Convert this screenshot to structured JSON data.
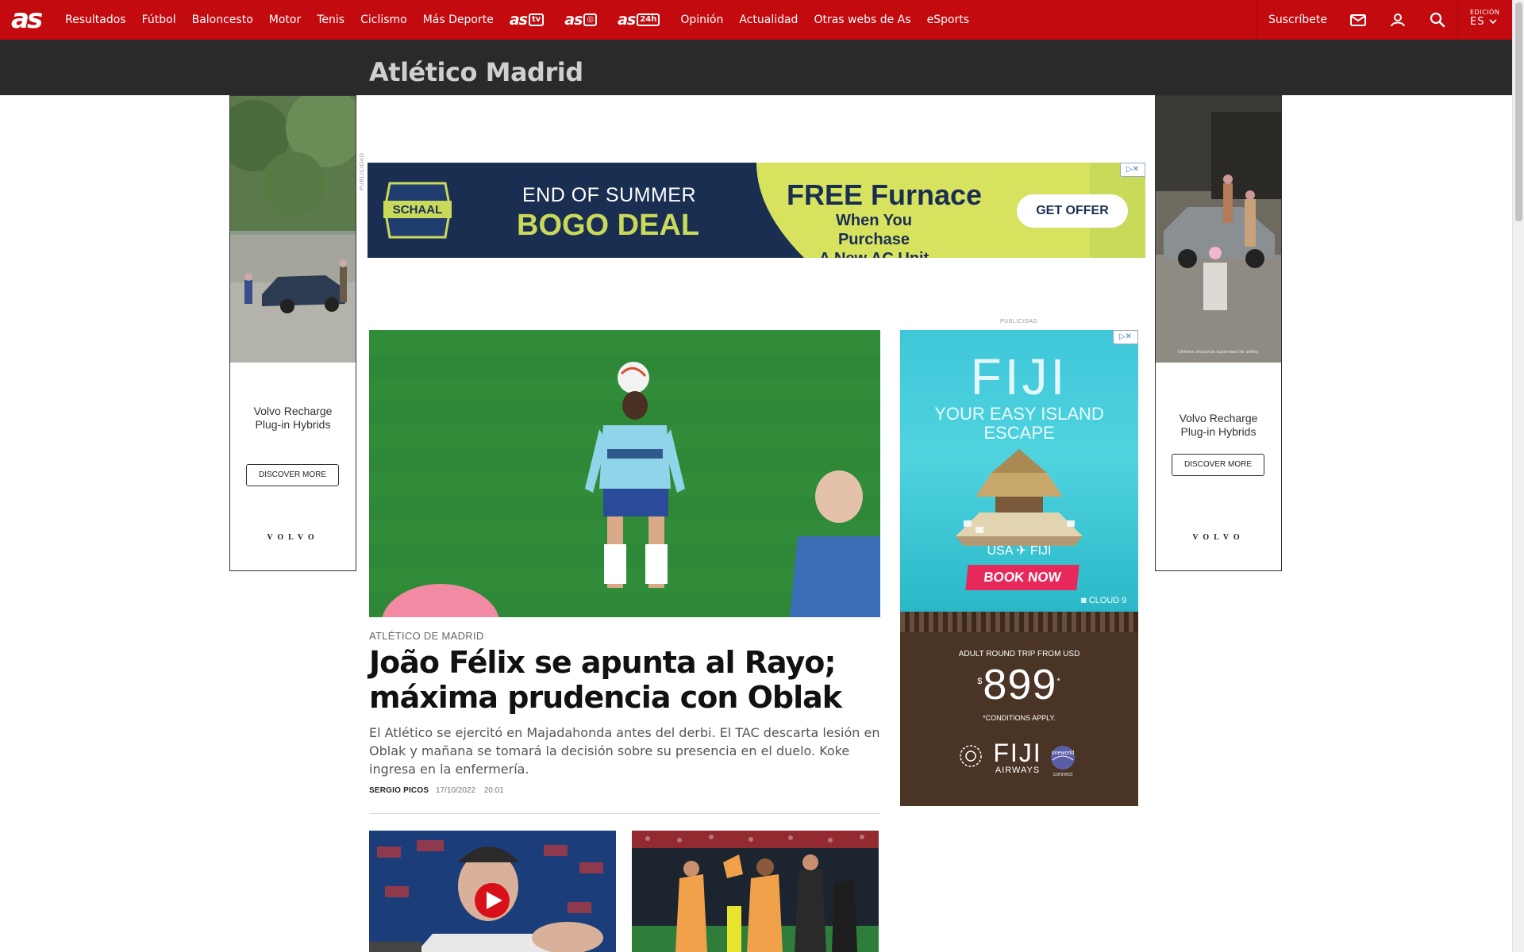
{
  "nav": {
    "logo": "as",
    "items": [
      "Resultados",
      "Fútbol",
      "Baloncesto",
      "Motor",
      "Tenis",
      "Ciclismo",
      "Más Deporte"
    ],
    "brands": [
      {
        "text": "as",
        "tag": "tv"
      },
      {
        "text": "as",
        "tag": "◎"
      },
      {
        "text": "as",
        "tag": "24h"
      }
    ],
    "items_after": [
      "Opinión",
      "Actualidad",
      "Otras webs de As",
      "eSports"
    ],
    "subscribe": "Suscríbete",
    "edition_label": "EDICIÓN",
    "edition_value": "ES",
    "icons": [
      "mail-icon",
      "user-icon",
      "search-icon",
      "chevron-down-icon"
    ]
  },
  "section": {
    "title": "Atlético Madrid"
  },
  "ads": {
    "publicidad": "PUBLICIDAD",
    "volvo": {
      "headline_line1": "Volvo Recharge",
      "headline_line2": "Plug-in Hybrids",
      "cta": "DISCOVER MORE",
      "brand": "VOLVO",
      "disclaimer": "Children should be supervised for safety."
    },
    "schaal": {
      "logo": "SCHAAL",
      "line1": "END OF SUMMER",
      "line2": "BOGO DEAL",
      "line3": "FREE Furnace",
      "line4": "When You Purchase",
      "line5": "A New AC Unit",
      "cta": "GET OFFER"
    },
    "fiji": {
      "title": "FIJI",
      "subtitle1": "YOUR EASY ISLAND",
      "subtitle2": "ESCAPE",
      "route": "USA ✈ FIJI",
      "cta": "BOOK NOW",
      "photo_credit": "CLOUD 9",
      "price_label": "ADULT ROUND TRIP FROM USD",
      "currency": "$",
      "price": "899",
      "price_mark": "*",
      "conditions": "*CONDITIONS APPLY.",
      "airline": "FIJI",
      "airline_sub": "AIRWAYS",
      "alliance": "oneworld",
      "alliance_sub": "connect"
    }
  },
  "article": {
    "kicker": "ATLÉTICO DE MADRID",
    "headline": "João Félix se apunta al Rayo; máxima prudencia con Oblak",
    "summary": "El Atlético se ejercitó en Majadahonda antes del derbi. El TAC descarta lesión en Oblak y mañana se tomará la decisión sobre su presencia en el duelo. Koke ingresa en la enfermería.",
    "author": "SERGIO PICOS",
    "date": "17/10/2022",
    "time": "20:01"
  },
  "colors": {
    "brand_red": "#c20a0f",
    "section_bar": "#2a2a2a",
    "pitch_green": "#2f8a3a"
  }
}
